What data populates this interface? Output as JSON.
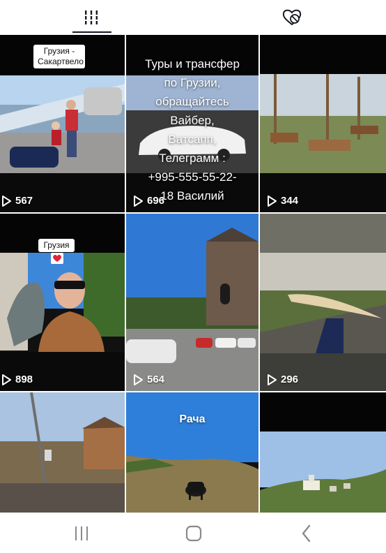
{
  "tabs": [
    {
      "id": "videos",
      "icon": "grid-icon",
      "active": true
    },
    {
      "id": "liked",
      "icon": "heart-hidden-icon",
      "active": false
    }
  ],
  "grid": {
    "items": [
      {
        "views": "567",
        "caption": "Грузия -\nСакартвело"
      },
      {
        "views": "696",
        "overlay": "Туры и трансфер\nпо Грузии,\nобращайтесь\nВайбер,\nВатсапп,\nТелеграмм :\n+995-555-55-22-\n18 Василий"
      },
      {
        "views": "344"
      },
      {
        "views": "898",
        "caption": "Грузия"
      },
      {
        "views": "564"
      },
      {
        "views": "296"
      },
      {},
      {
        "label": "Рача"
      },
      {}
    ]
  },
  "navbar": {
    "icons": [
      "recent-apps-icon",
      "home-icon",
      "back-icon"
    ]
  },
  "colors": {
    "text_primary": "#161823",
    "nav_icon": "#8a8a8a"
  }
}
